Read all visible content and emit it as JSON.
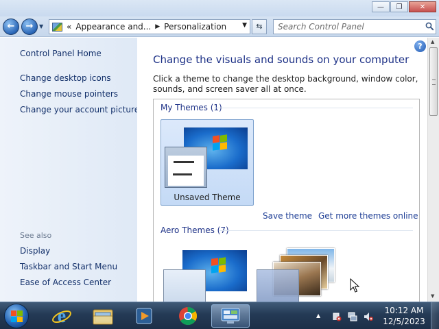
{
  "window": {
    "controls": {
      "minimize": "—",
      "maximize": "❐",
      "close": "✕"
    }
  },
  "navigation": {
    "back_glyph": "←",
    "forward_glyph": "→",
    "recent_glyph": "▼",
    "breadcrumb": {
      "overflow": "«",
      "items": [
        "Appearance and...",
        "Personalization"
      ],
      "separator": "▶"
    },
    "dropdown_glyph": "▼",
    "refresh_glyph": "⇆",
    "search_placeholder": "Search Control Panel"
  },
  "sidebar": {
    "home_link": "Control Panel Home",
    "links": [
      "Change desktop icons",
      "Change mouse pointers",
      "Change your account picture"
    ],
    "see_also_heading": "See also",
    "see_also_links": [
      "Display",
      "Taskbar and Start Menu",
      "Ease of Access Center"
    ]
  },
  "main": {
    "help_glyph": "?",
    "heading": "Change the visuals and sounds on your computer",
    "description": "Click a theme to change the desktop background, window color, sounds, and screen saver all at once.",
    "my_themes_title": "My Themes (1)",
    "my_themes": [
      {
        "name": "Unsaved Theme",
        "selected": true
      }
    ],
    "save_theme_link": "Save theme",
    "get_more_link": "Get more themes online",
    "aero_themes_title": "Aero Themes (7)"
  },
  "taskbar": {
    "pinned": [
      "start-orb",
      "internet-explorer",
      "windows-explorer",
      "media-player",
      "chrome",
      "control-panel"
    ],
    "active_item": "control-panel",
    "tray_overflow_glyph": "▲",
    "clock": {
      "time": "10:12 AM",
      "date": "12/5/2023"
    }
  },
  "colors": {
    "link": "#13306a",
    "heading": "#1e3287",
    "sidebar_bg": "#e6eef8",
    "selection": "#cfe0f8",
    "taskbar": "#243a55"
  }
}
